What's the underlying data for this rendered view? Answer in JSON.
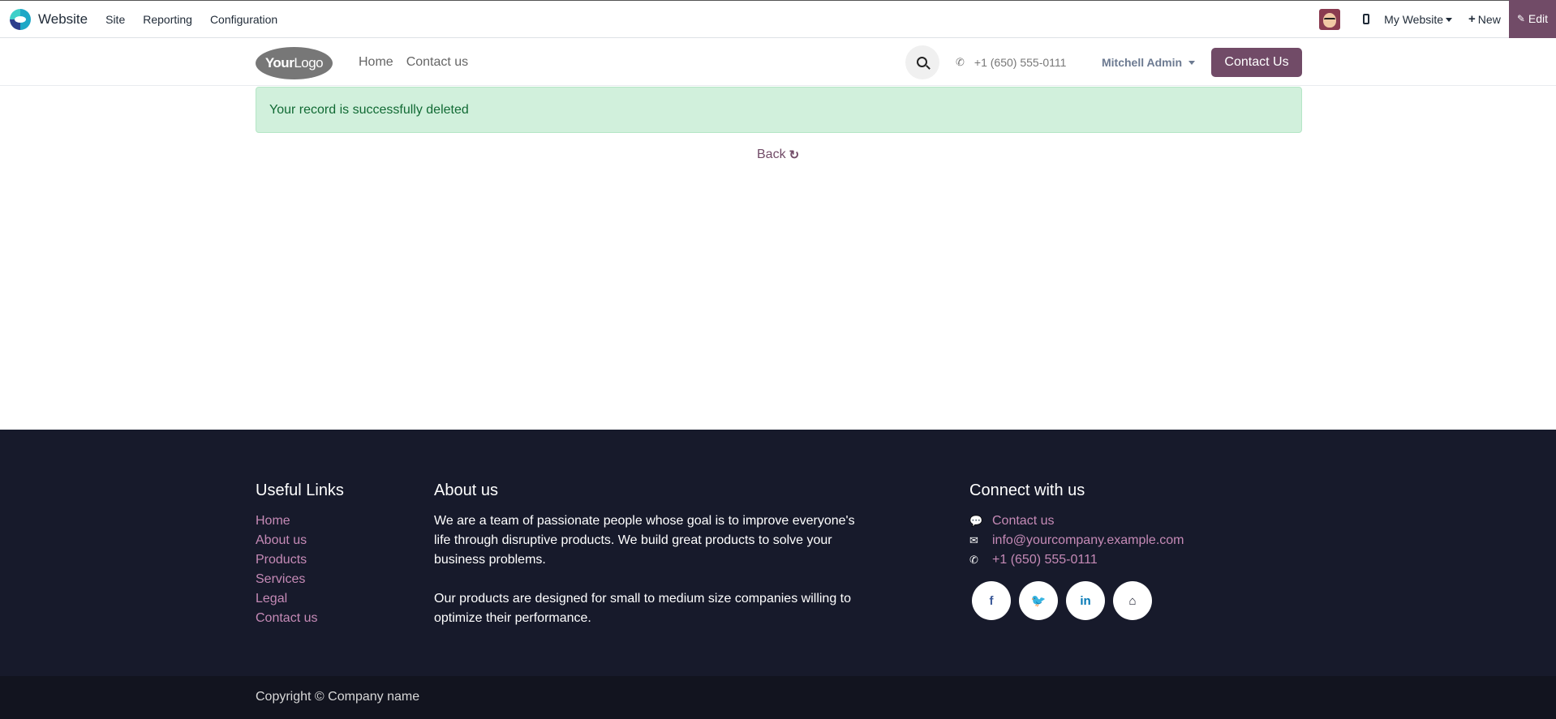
{
  "topbar": {
    "app_name": "Website",
    "menu": [
      "Site",
      "Reporting",
      "Configuration"
    ],
    "website_selector": "My Website",
    "new_label": "New",
    "edit_label": "Edit"
  },
  "header": {
    "logo_bold": "Your",
    "logo_thin": "Logo",
    "nav": [
      "Home",
      "Contact us"
    ],
    "phone": "+1 (650) 555-0111",
    "user": "Mitchell Admin",
    "cta": "Contact Us"
  },
  "main": {
    "alert": "Your record is successfully deleted",
    "back": "Back"
  },
  "footer": {
    "links_title": "Useful Links",
    "links": [
      "Home",
      "About us",
      "Products",
      "Services",
      "Legal",
      "Contact us"
    ],
    "about_title": "About us",
    "about_p1": "We are a team of passionate people whose goal is to improve everyone's life through disruptive products. We build great products to solve your business problems.",
    "about_p2": "Our products are designed for small to medium size companies willing to optimize their performance.",
    "connect_title": "Connect with us",
    "contact": {
      "contact_us": "Contact us",
      "email": "info@yourcompany.example.com",
      "phone": "+1 (650) 555-0111"
    },
    "social": [
      "f",
      "t",
      "in",
      "home"
    ],
    "copyright": "Copyright © Company name"
  },
  "colors": {
    "brand": "#714b67",
    "footer_bg": "#171a2b",
    "alert_bg": "#d1f0dc",
    "link": "#c58ab6"
  }
}
